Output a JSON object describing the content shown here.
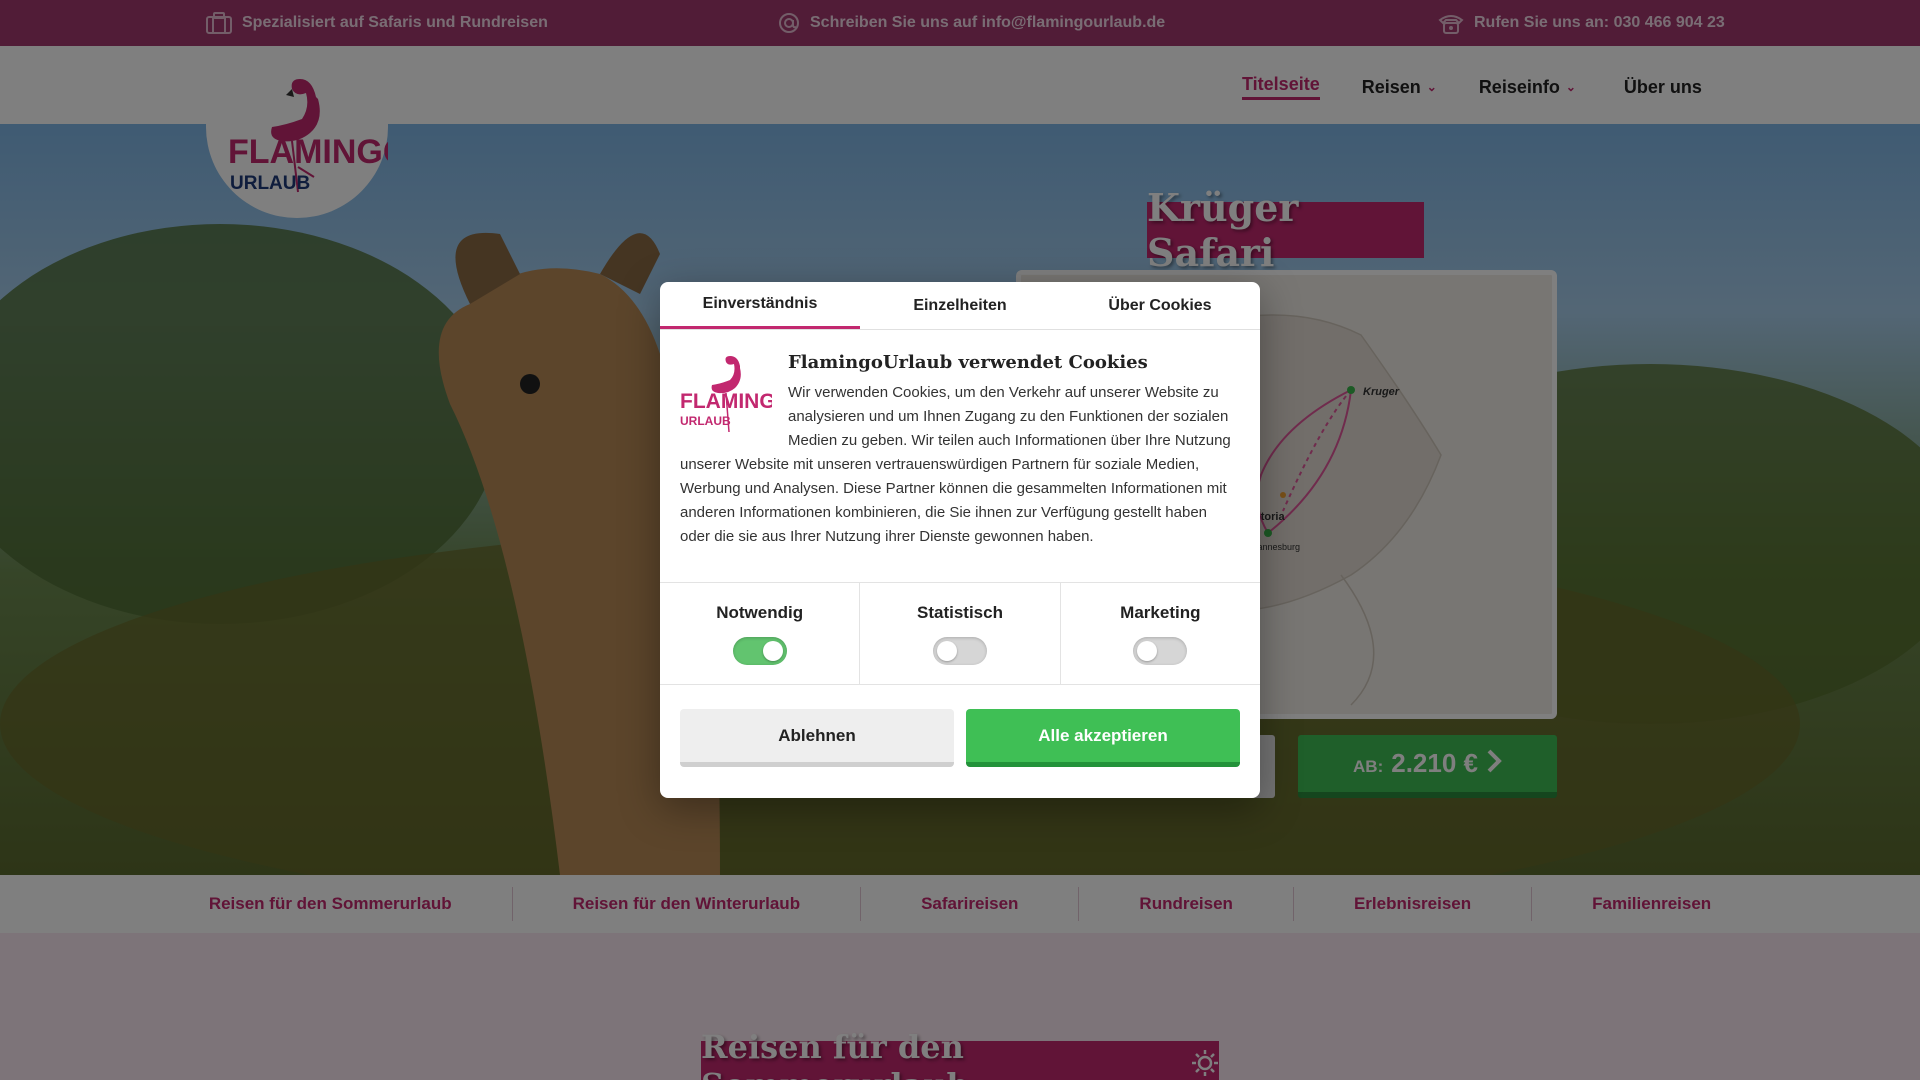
{
  "topbar": {
    "specialized": "Spezialisiert auf Safaris und Rundreisen",
    "email": "Schreiben Sie uns auf info@flamingourlaub.de",
    "phone": "Rufen Sie uns an: 030 466 904 23"
  },
  "logo": {
    "line1": "FLAMINGO",
    "line2": "URLAUB"
  },
  "nav": {
    "items": [
      {
        "label": "Titelseite",
        "active": true
      },
      {
        "label": "Reisen",
        "dropdown": true
      },
      {
        "label": "Reiseinfo",
        "dropdown": true
      },
      {
        "label": "Über uns"
      }
    ]
  },
  "hero": {
    "title": "Krüger Safari",
    "map": {
      "labels": [
        "Kruger",
        "Pretoria",
        "Johannesburg"
      ]
    },
    "price_prefix": "AB:",
    "price": "2.210 €"
  },
  "categories": [
    "Reisen für den Sommerurlaub",
    "Reisen für den Winterurlaub",
    "Safarireisen",
    "Rundreisen",
    "Erlebnisreisen",
    "Familienreisen"
  ],
  "section": {
    "title": "Reisen für den Sommerurlaub"
  },
  "cookie_dialog": {
    "tabs": [
      "Einverständnis",
      "Einzelheiten",
      "Über Cookies"
    ],
    "title": "FlamingoUrlaub verwendet Cookies",
    "text": "Wir verwenden Cookies, um den Verkehr auf unserer Website zu analysieren und um Ihnen Zugang zu den Funktionen der sozialen Medien zu geben. Wir teilen auch Informationen über Ihre Nutzung unserer Website mit unseren vertrauenswürdigen Partnern für soziale Medien, Werbung und Analysen. Diese Partner können die gesammelten Informationen mit anderen Informationen kombinieren, die Sie ihnen zur Verfügung gestellt haben oder die sie aus Ihrer Nutzung ihrer Dienste gewonnen haben.",
    "toggles": [
      {
        "label": "Notwendig",
        "on": true
      },
      {
        "label": "Statistisch",
        "on": false
      },
      {
        "label": "Marketing",
        "on": false
      }
    ],
    "decline": "Ablehnen",
    "accept": "Alle akzeptieren"
  },
  "colors": {
    "brand": "#c2286f",
    "topbar": "#a3386f",
    "accept": "#3fbf55"
  }
}
